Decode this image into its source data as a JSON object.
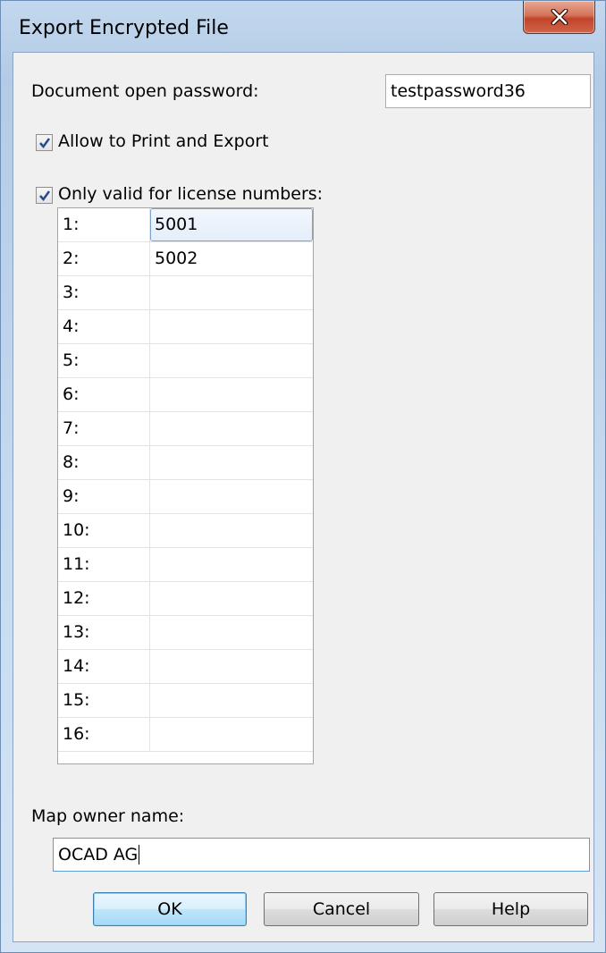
{
  "window": {
    "title": "Export Encrypted File"
  },
  "password": {
    "label": "Document open password:",
    "value": "testpassword36"
  },
  "allow_print": {
    "label": "Allow to Print and Export",
    "checked": true
  },
  "license": {
    "label": "Only valid for license numbers:",
    "checked": true,
    "rows": [
      {
        "num": "1:",
        "value": "5001"
      },
      {
        "num": "2:",
        "value": "5002"
      },
      {
        "num": "3:",
        "value": ""
      },
      {
        "num": "4:",
        "value": ""
      },
      {
        "num": "5:",
        "value": ""
      },
      {
        "num": "6:",
        "value": ""
      },
      {
        "num": "7:",
        "value": ""
      },
      {
        "num": "8:",
        "value": ""
      },
      {
        "num": "9:",
        "value": ""
      },
      {
        "num": "10:",
        "value": ""
      },
      {
        "num": "11:",
        "value": ""
      },
      {
        "num": "12:",
        "value": ""
      },
      {
        "num": "13:",
        "value": ""
      },
      {
        "num": "14:",
        "value": ""
      },
      {
        "num": "15:",
        "value": ""
      },
      {
        "num": "16:",
        "value": ""
      }
    ]
  },
  "owner": {
    "label": "Map owner name:",
    "value": "OCAD AG"
  },
  "buttons": {
    "ok": "OK",
    "cancel": "Cancel",
    "help": "Help"
  }
}
